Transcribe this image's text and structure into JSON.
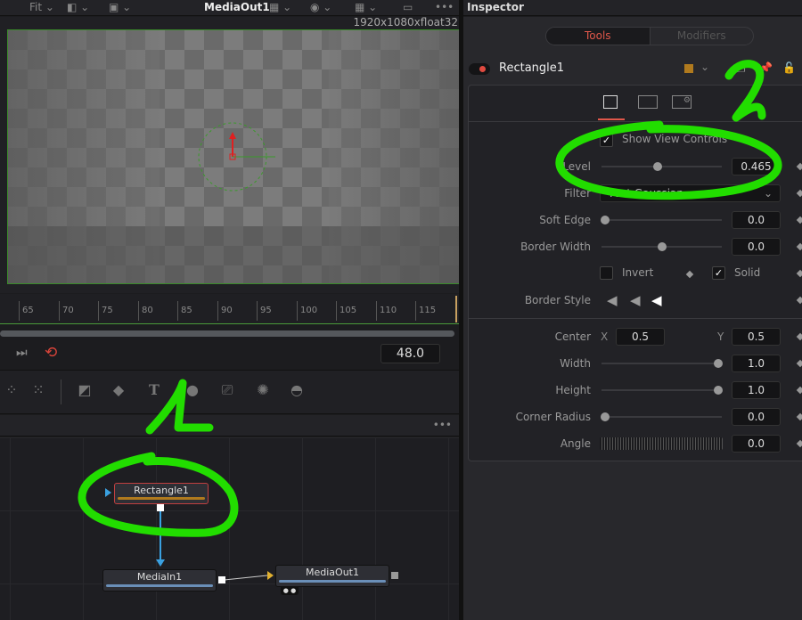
{
  "viewer": {
    "fit_label": "Fit",
    "title": "MediaOut1",
    "resolution": "1920x1080xfloat32",
    "more": "•••"
  },
  "timeline": {
    "ticks": [
      "65",
      "70",
      "75",
      "80",
      "85",
      "90",
      "95",
      "100",
      "105",
      "110",
      "115"
    ],
    "current_frame": "48.0"
  },
  "node_panel": {
    "more": "•••",
    "nodes": [
      {
        "label": "Rectangle1",
        "color": "#b07a1e"
      },
      {
        "label": "MediaIn1",
        "color": "#6a8fb8"
      },
      {
        "label": "MediaOut1",
        "color": "#6a8fb8"
      }
    ]
  },
  "inspector": {
    "title": "Inspector",
    "tabs": [
      "Tools",
      "Modifiers"
    ],
    "active_tab": "Tools",
    "tool_name": "Rectangle1",
    "tool_color": "#b07a1e",
    "show_view_controls": "Show View Controls",
    "level": {
      "label": "Level",
      "value": "0.465",
      "fraction": 0.465
    },
    "filter": {
      "label": "Filter",
      "value": "Fast Gaussian"
    },
    "soft_edge": {
      "label": "Soft Edge",
      "value": "0.0"
    },
    "border_width": {
      "label": "Border Width",
      "value": "0.0"
    },
    "invert": {
      "label": "Invert",
      "checked": false
    },
    "solid": {
      "label": "Solid",
      "checked": true
    },
    "border_style": {
      "label": "Border Style"
    },
    "center": {
      "label": "Center",
      "x_label": "X",
      "x": "0.5",
      "y_label": "Y",
      "y": "0.5"
    },
    "width": {
      "label": "Width",
      "value": "1.0"
    },
    "height": {
      "label": "Height",
      "value": "1.0"
    },
    "corner_radius": {
      "label": "Corner Radius",
      "value": "0.0"
    },
    "angle": {
      "label": "Angle",
      "value": "0.0"
    }
  },
  "annotations": {
    "mark_1": "1",
    "mark_2": "2",
    "color": "#22dd00"
  }
}
